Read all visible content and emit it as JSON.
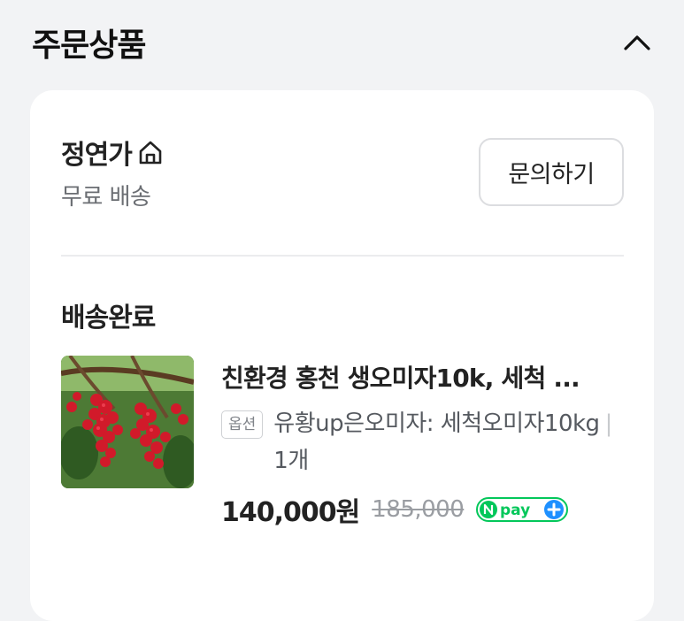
{
  "section": {
    "title": "주문상품"
  },
  "seller": {
    "name": "정연가",
    "shipping": "무료 배송",
    "inquiry_label": "문의하기"
  },
  "order": {
    "status": "배송완료",
    "product": {
      "name": "친환경 홍천 생오미자10k, 세척 ...",
      "option_tag": "옵션",
      "option": "유황up은오미자: 세척오미자10kg",
      "quantity": "1개",
      "price": "140,000원",
      "original_price": "185,000",
      "badge": "Npay+"
    }
  },
  "colors": {
    "npay_green": "#03c75a",
    "npay_blue": "#1e90ff"
  }
}
